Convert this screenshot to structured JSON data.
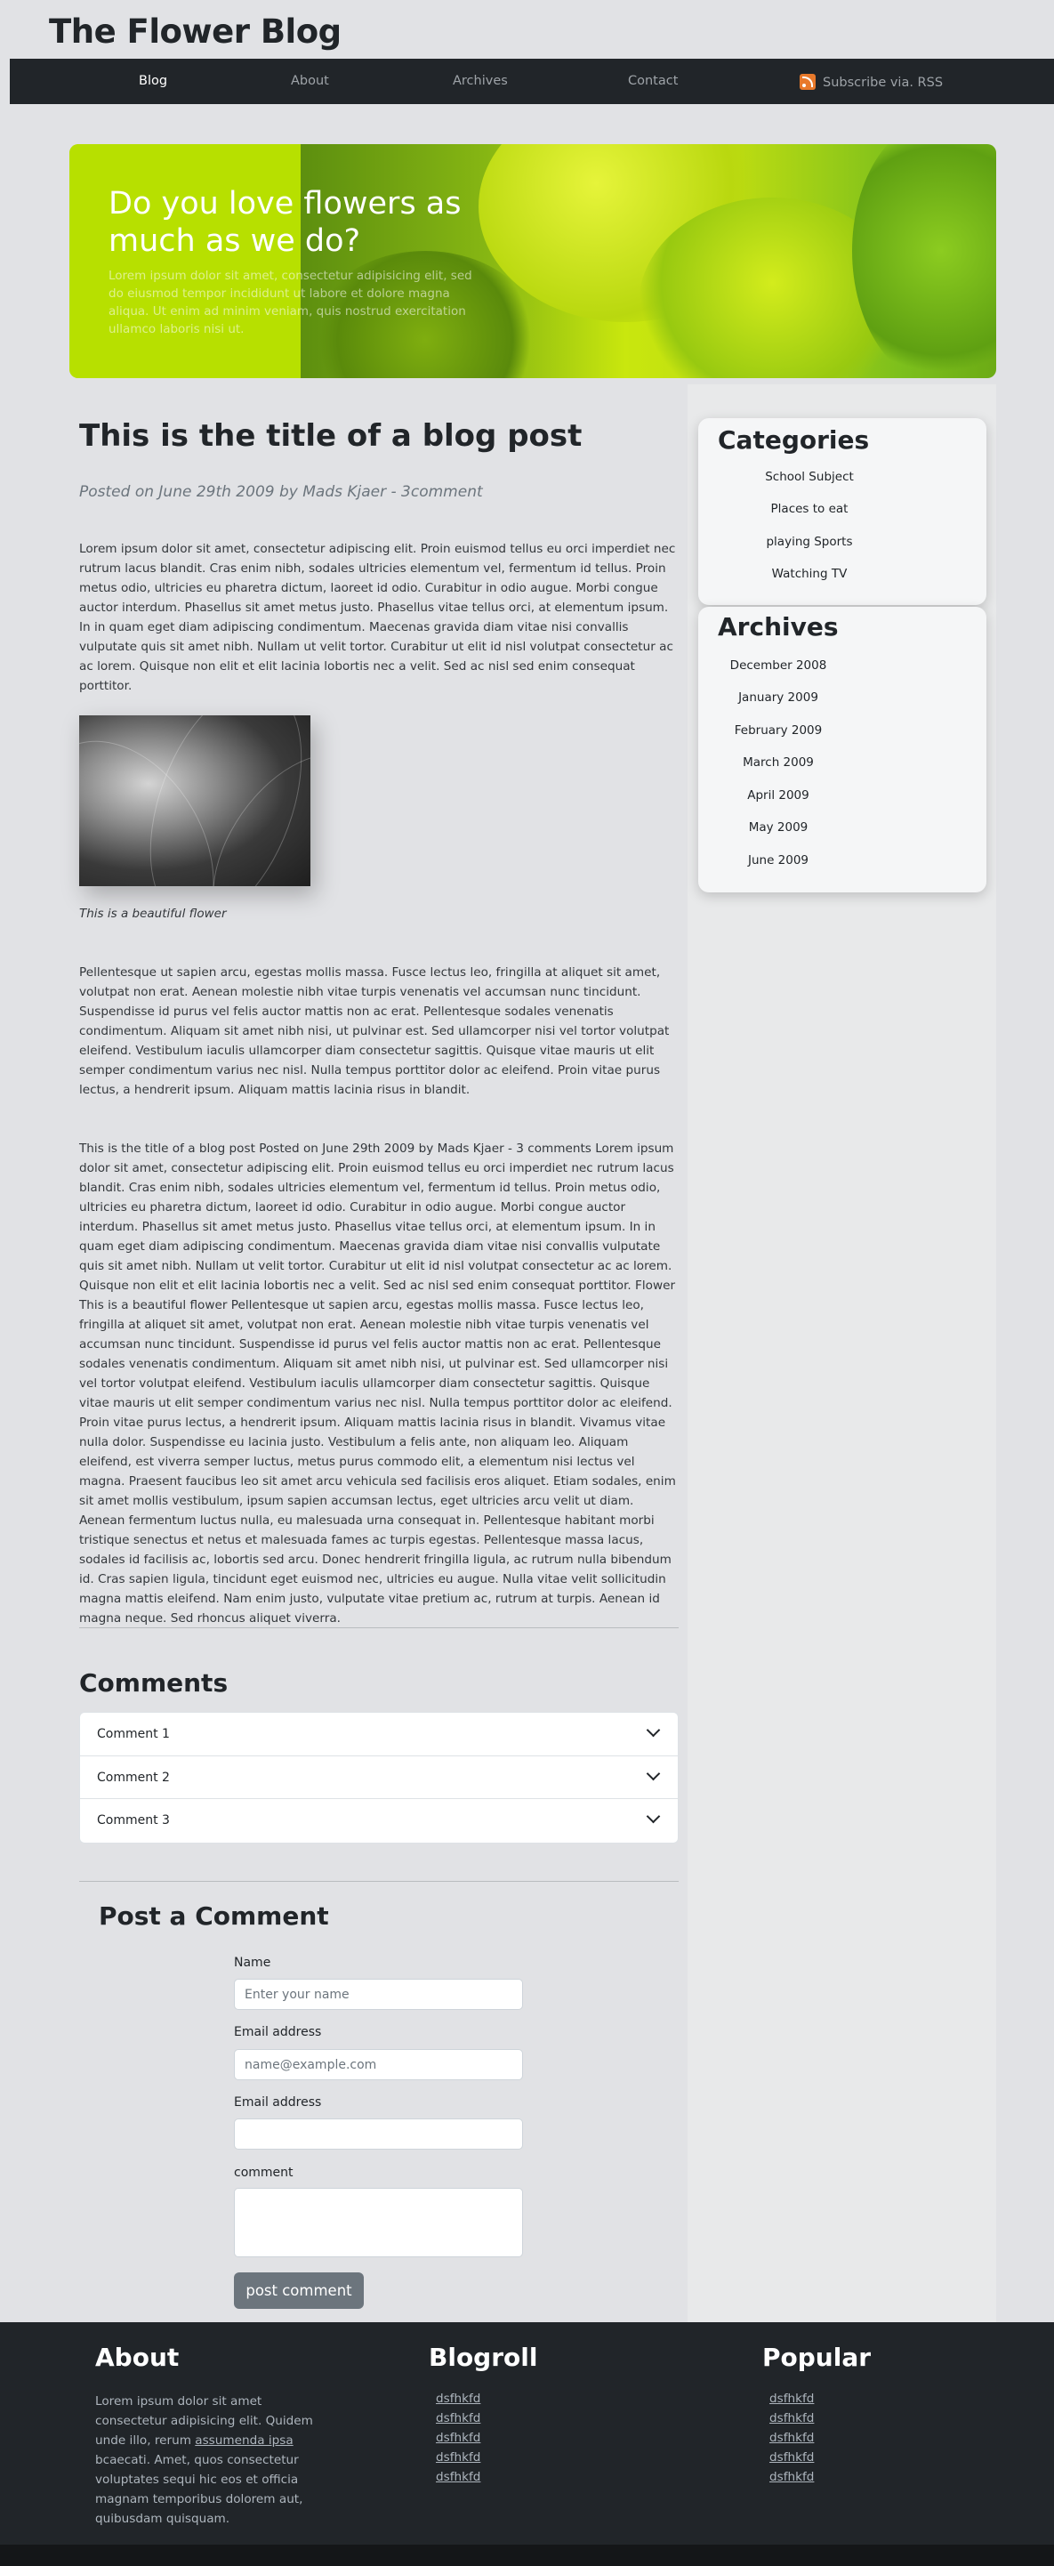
{
  "site": {
    "title": "The Flower Blog"
  },
  "nav": {
    "items": [
      {
        "label": "Blog",
        "active": true
      },
      {
        "label": "About",
        "active": false
      },
      {
        "label": "Archives",
        "active": false
      },
      {
        "label": "Contact",
        "active": false
      }
    ],
    "rss_label": "Subscribe via. RSS",
    "rss_icon": "rss-icon"
  },
  "hero": {
    "title": "Do you love flowers as much as we do?",
    "text": "Lorem ipsum dolor sit amet, consectetur adipisicing elit, sed do eiusmod tempor incididunt ut labore et dolore magna aliqua. Ut enim ad minim veniam, quis nostrud exercitation ullamco laboris nisi ut."
  },
  "post": {
    "title": "This is the title of a blog post",
    "meta": "Posted on June 29th 2009 by Mads Kjaer - 3comment",
    "paragraph1": "Lorem ipsum dolor sit amet, consectetur adipiscing elit. Proin euismod tellus eu orci imperdiet nec rutrum lacus blandit. Cras enim nibh, sodales ultricies elementum vel, fermentum id tellus. Proin metus odio, ultricies eu pharetra dictum, laoreet id odio. Curabitur in odio augue. Morbi congue auctor interdum. Phasellus sit amet metus justo. Phasellus vitae tellus orci, at elementum ipsum. In in quam eget diam adipiscing condimentum. Maecenas gravida diam vitae nisi convallis vulputate quis sit amet nibh. Nullam ut velit tortor. Curabitur ut elit id nisl volutpat consectetur ac ac lorem. Quisque non elit et elit lacinia lobortis nec a velit. Sed ac nisl sed enim consequat porttitor.",
    "image_caption": "This is a beautiful flower",
    "paragraph2": "Pellentesque ut sapien arcu, egestas mollis massa. Fusce lectus leo, fringilla at aliquet sit amet, volutpat non erat. Aenean molestie nibh vitae turpis venenatis vel accumsan nunc tincidunt. Suspendisse id purus vel felis auctor mattis non ac erat. Pellentesque sodales venenatis condimentum. Aliquam sit amet nibh nisi, ut pulvinar est. Sed ullamcorper nisi vel tortor volutpat eleifend. Vestibulum iaculis ullamcorper diam consectetur sagittis. Quisque vitae mauris ut elit semper condimentum varius nec nisl. Nulla tempus porttitor dolor ac eleifend. Proin vitae purus lectus, a hendrerit ipsum. Aliquam mattis lacinia risus in blandit.",
    "paragraph3": "This is the title of a blog post Posted on June 29th 2009 by Mads Kjaer - 3 comments Lorem ipsum dolor sit amet, consectetur adipiscing elit. Proin euismod tellus eu orci imperdiet nec rutrum lacus blandit. Cras enim nibh, sodales ultricies elementum vel, fermentum id tellus. Proin metus odio, ultricies eu pharetra dictum, laoreet id odio. Curabitur in odio augue. Morbi congue auctor interdum. Phasellus sit amet metus justo. Phasellus vitae tellus orci, at elementum ipsum. In in quam eget diam adipiscing condimentum. Maecenas gravida diam vitae nisi convallis vulputate quis sit amet nibh. Nullam ut velit tortor. Curabitur ut elit id nisl volutpat consectetur ac ac lorem. Quisque non elit et elit lacinia lobortis nec a velit. Sed ac nisl sed enim consequat porttitor. Flower This is a beautiful flower Pellentesque ut sapien arcu, egestas mollis massa. Fusce lectus leo, fringilla at aliquet sit amet, volutpat non erat. Aenean molestie nibh vitae turpis venenatis vel accumsan nunc tincidunt. Suspendisse id purus vel felis auctor mattis non ac erat. Pellentesque sodales venenatis condimentum. Aliquam sit amet nibh nisi, ut pulvinar est. Sed ullamcorper nisi vel tortor volutpat eleifend. Vestibulum iaculis ullamcorper diam consectetur sagittis. Quisque vitae mauris ut elit semper condimentum varius nec nisl. Nulla tempus porttitor dolor ac eleifend. Proin vitae purus lectus, a hendrerit ipsum. Aliquam mattis lacinia risus in blandit. Vivamus vitae nulla dolor. Suspendisse eu lacinia justo. Vestibulum a felis ante, non aliquam leo. Aliquam eleifend, est viverra semper luctus, metus purus commodo elit, a elementum nisi lectus vel magna. Praesent faucibus leo sit amet arcu vehicula sed facilisis eros aliquet. Etiam sodales, enim sit amet mollis vestibulum, ipsum sapien accumsan lectus, eget ultricies arcu velit ut diam. Aenean fermentum luctus nulla, eu malesuada urna consequat in. Pellentesque habitant morbi tristique senectus et netus et malesuada fames ac turpis egestas. Pellentesque massa lacus, sodales id facilisis ac, lobortis sed arcu. Donec hendrerit fringilla ligula, ac rutrum nulla bibendum id. Cras sapien ligula, tincidunt eget euismod nec, ultricies eu augue. Nulla vitae velit sollicitudin magna mattis eleifend. Nam enim justo, vulputate vitae pretium ac, rutrum at turpis. Aenean id magna neque. Sed rhoncus aliquet viverra."
  },
  "comments": {
    "title": "Comments",
    "items": [
      "Comment 1",
      "Comment 2",
      "Comment 3"
    ]
  },
  "comment_form": {
    "title": "Post a Comment",
    "name_label": "Name",
    "name_placeholder": "Enter your name",
    "email_label": "Email address",
    "email_placeholder": "name@example.com",
    "email2_label": "Email address",
    "comment_label": "comment",
    "submit_label": "post comment"
  },
  "sidebar": {
    "categories_title": "Categories",
    "categories": [
      "School Subject",
      "Places to eat",
      "playing Sports",
      "Watching TV"
    ],
    "archives_title": "Archives",
    "archives": [
      "December 2008",
      "January 2009",
      "February 2009",
      "March 2009",
      "April 2009",
      "May 2009",
      "June 2009"
    ]
  },
  "footer": {
    "about_title": "About",
    "about_text_before": "Lorem ipsum dolor sit amet consectetur adipisicing elit. Quidem unde illo, rerum ",
    "about_link": "assumenda ipsa",
    "about_text_after": " bcaecati. Amet, quos consectetur voluptates sequi hic eos et officia magnam temporibus dolorem aut, quibusdam quisquam.",
    "blogroll_title": "Blogroll",
    "blogroll_links": [
      "dsfhkfd",
      "dsfhkfd",
      "dsfhkfd",
      "dsfhkfd",
      "dsfhkfd"
    ],
    "popular_title": "Popular",
    "popular_links": [
      "dsfhkfd",
      "dsfhkfd",
      "dsfhkfd",
      "dsfhkfd",
      "dsfhkfd"
    ]
  },
  "colors": {
    "page_bg": "#e1e2e5",
    "navbar_bg": "#212529",
    "footer_bg": "#212529",
    "button_bg": "#6c757d",
    "rss_orange": "#e8792b"
  }
}
